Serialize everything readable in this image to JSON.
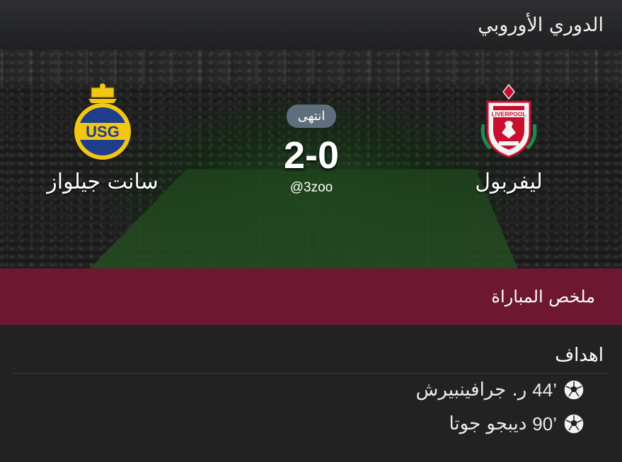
{
  "header": {
    "title": "الدوري الأوروبي"
  },
  "match": {
    "status": "انتهى",
    "score": "2-0",
    "handle": "@3zoo",
    "home_team": {
      "name": "ليفربول",
      "logo": "liverpool-crest-icon",
      "logo_text": "LIVERPOOL"
    },
    "away_team": {
      "name": "سانت جيلواز",
      "logo": "usg-crest-icon",
      "logo_text": "USG"
    }
  },
  "summary": {
    "title": "ملخص المباراة"
  },
  "goals": {
    "title": "اهداف",
    "items": [
      {
        "minute": "44’",
        "player": "ر. جرافينبيرش",
        "icon": "soccer-ball-icon"
      },
      {
        "minute": "90’",
        "player": "ديبجو جوتا",
        "icon": "soccer-ball-icon"
      }
    ]
  },
  "colors": {
    "summary_bar": "#6d1730",
    "status_badge": "#5f6e7d",
    "background": "#222222"
  }
}
